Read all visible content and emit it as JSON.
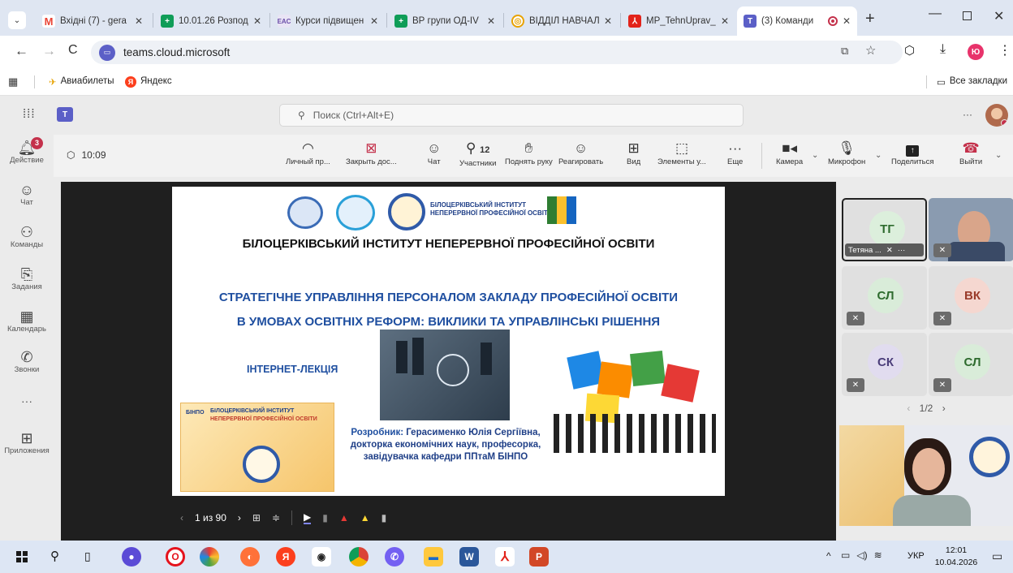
{
  "browser": {
    "tabs": [
      {
        "title": "Вхідні (7) - gera",
        "icon": "gmail-icon",
        "color": "#ea4335"
      },
      {
        "title": "10.01.26 Розпод",
        "icon": "sheets-icon",
        "color": "#0f9d58"
      },
      {
        "title": "Курси підвищен",
        "icon": "eac-icon",
        "color": "#6a4da8"
      },
      {
        "title": "ВР групи ОД-IV",
        "icon": "sheets-icon",
        "color": "#0f9d58"
      },
      {
        "title": "ВІДДІЛ НАВЧАЛ",
        "icon": "chrome-icon",
        "color": "#e8a200"
      },
      {
        "title": "MP_TehnUprav_",
        "icon": "pdf-icon",
        "color": "#e2231a"
      },
      {
        "title": "(3) Команди",
        "icon": "teams-icon",
        "color": "#5b5fc7"
      }
    ],
    "new_tab": "+",
    "url": "teams.cloud.microsoft",
    "bookmarks": [
      {
        "label": "Авиабилеты",
        "icon": "plane-icon"
      },
      {
        "label": "Яндекс",
        "icon": "yandex-icon"
      }
    ],
    "all_bookmarks": "Все закладки",
    "profile_initial": "Ю"
  },
  "teams": {
    "search_placeholder": "Поиск (Ctrl+Alt+E)",
    "more": "···",
    "rail": [
      {
        "label": "Действие",
        "icon": "bell-icon",
        "badge": "3"
      },
      {
        "label": "Чат",
        "icon": "chat-icon"
      },
      {
        "label": "Команды",
        "icon": "teams-people-icon"
      },
      {
        "label": "Задания",
        "icon": "assignments-icon"
      },
      {
        "label": "Календарь",
        "icon": "calendar-icon"
      },
      {
        "label": "Звонки",
        "icon": "phone-icon"
      },
      {
        "label": "···",
        "icon": "more-icon"
      },
      {
        "label": "Приложения",
        "icon": "apps-icon"
      }
    ],
    "meeting": {
      "timer": "10:09",
      "toolbar": [
        {
          "label": "Личный пр...",
          "icon": "eye-icon"
        },
        {
          "label": "Закрыть дос...",
          "icon": "close-share-icon"
        },
        {
          "label": "Чат",
          "icon": "chat-icon"
        },
        {
          "label": "Участники",
          "icon": "people-icon",
          "count": "12"
        },
        {
          "label": "Поднять руку",
          "icon": "hand-icon"
        },
        {
          "label": "Реагировать",
          "icon": "emoji-icon"
        },
        {
          "label": "Вид",
          "icon": "grid-icon"
        },
        {
          "label": "Элементы у...",
          "icon": "apps-icon"
        },
        {
          "label": "Еще",
          "icon": "more-icon"
        },
        {
          "label": "Камера",
          "icon": "camera-icon"
        },
        {
          "label": "Микрофон",
          "icon": "mic-icon"
        },
        {
          "label": "Поделиться",
          "icon": "share-icon"
        },
        {
          "label": "Выйти",
          "icon": "hangup-icon"
        }
      ],
      "pager": {
        "current": "1 из 90"
      },
      "participants": [
        {
          "initials": "ТГ",
          "name": "Тетяна ...",
          "bg": "#dcefdc",
          "fg": "#2e6b2e"
        },
        {
          "initials": "",
          "name": "",
          "bg": "#7c8fa6",
          "fg": "#fff"
        },
        {
          "initials": "СЛ",
          "name": "",
          "bg": "#d9ecd9",
          "fg": "#2e6b2e"
        },
        {
          "initials": "ВК",
          "name": "",
          "bg": "#f5d7d0",
          "fg": "#9a3b2a"
        },
        {
          "initials": "СК",
          "name": "",
          "bg": "#e1dcef",
          "fg": "#4b3e7a"
        },
        {
          "initials": "СЛ",
          "name": "",
          "bg": "#d9ecd9",
          "fg": "#2e6b2e"
        }
      ],
      "page_indicator": "1/2"
    },
    "slide": {
      "logo_text1": "БІЛОЦЕРКІВСЬКИЙ ІНСТИТУТ",
      "logo_text2": "НЕПЕРЕРВНОЇ ПРОФЕСІЙНОЇ ОСВІТИ",
      "institute": "БІЛОЦЕРКІВСЬКИЙ ІНСТИТУТ НЕПЕРЕРВНОЇ ПРОФЕСІЙНОЇ ОСВІТИ",
      "title_line1": "СТРАТЕГІЧНЕ УПРАВЛІННЯ ПЕРСОНАЛОМ ЗАКЛАДУ ПРОФЕСІЙНОЇ ОСВІТИ",
      "title_line2": "В УМОВАХ ОСВІТНІХ РЕФОРМ: ВИКЛИКИ ТА УПРАВЛІНСЬКІ РІШЕННЯ",
      "type": "ІНТЕРНЕТ-ЛЕКЦІЯ",
      "author_label": "Розробник:",
      "author_name": "Герасименко Юлія Сергіївна,",
      "author_line2": "докторка економічних наук, професорка,",
      "author_line3": "завідувачка кафедри ППтаМ БІНПО",
      "badge_text": "БІНПО"
    }
  },
  "taskbar": {
    "lang": "УКР",
    "time": "12:01",
    "date": "10.04.2026"
  },
  "colors": {
    "teams_accent": "#5b5fc7",
    "slide_title_blue": "#1f4fa0",
    "hangup_red": "#c4314b"
  }
}
